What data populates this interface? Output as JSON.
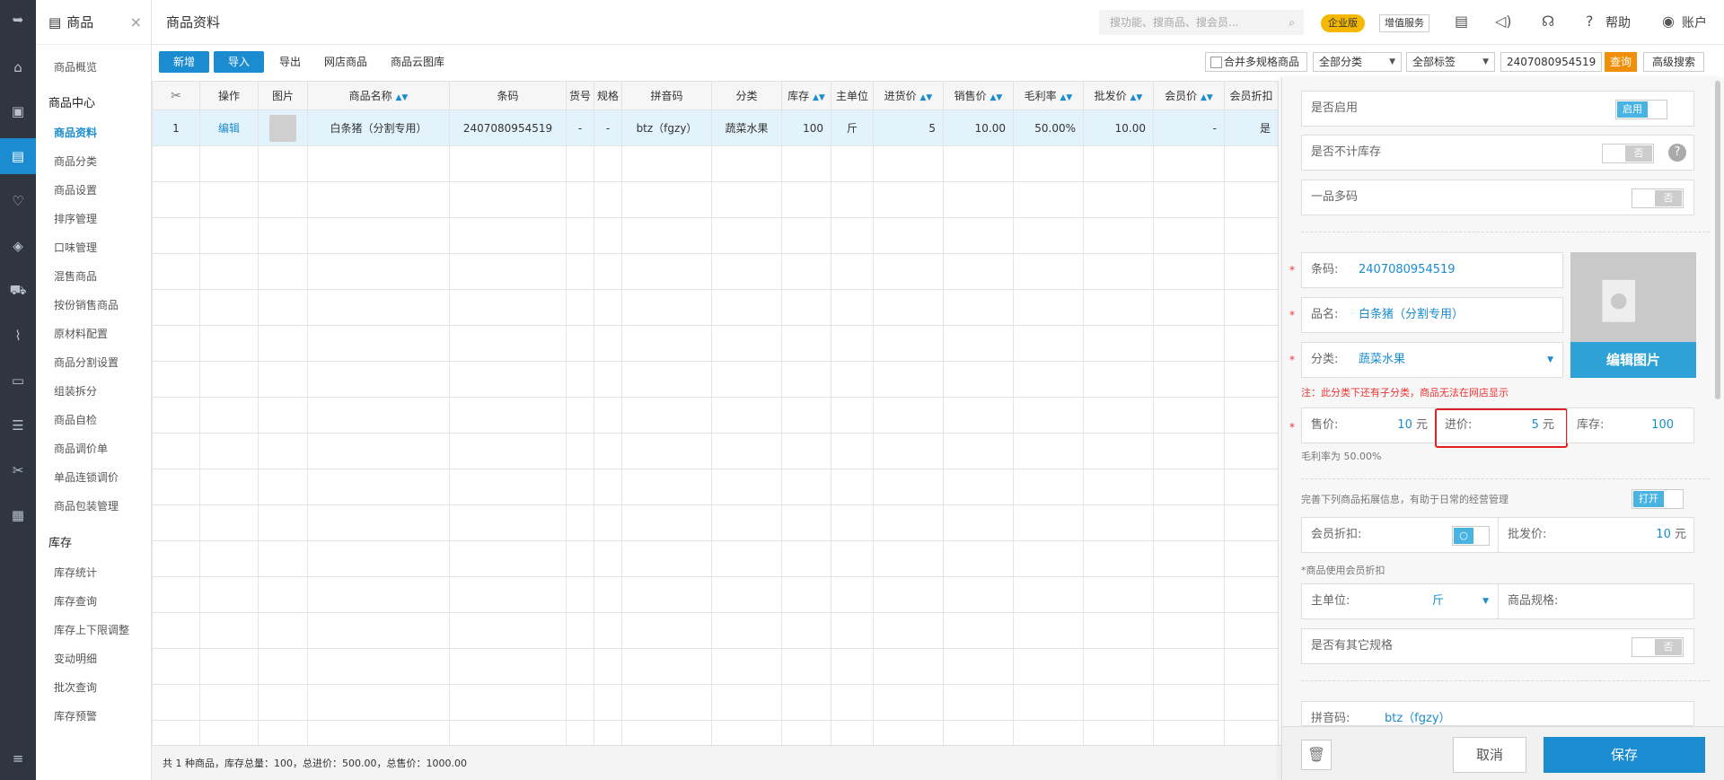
{
  "nav": {
    "title": "商品",
    "close": "×",
    "items": [
      "商品概览"
    ],
    "group1": "商品中心",
    "group1_items": [
      "商品资料",
      "商品分类",
      "商品设置",
      "排序管理",
      "口味管理",
      "混售商品",
      "按份销售商品",
      "原材料配置",
      "商品分割设置",
      "组装拆分",
      "商品自检",
      "商品调价单",
      "单品连锁调价",
      "商品包装管理"
    ],
    "group2": "库存",
    "group2_items": [
      "库存统计",
      "库存查询",
      "库存上下限调整",
      "变动明细",
      "批次查询",
      "库存预警"
    ]
  },
  "topbar": {
    "title": "商品资料",
    "search_placeholder": "搜功能、搜商品、搜会员...",
    "badge_enterprise": "企业版",
    "badge_vas": "增值服务",
    "help": "帮助",
    "account": "账户"
  },
  "toolbar": {
    "new": "新增",
    "import": "导入",
    "export": "导出",
    "online": "网店商品",
    "cloud": "商品云图库",
    "merge_spec": "合并多规格商品",
    "category": "全部分类",
    "tag": "全部标签",
    "query_value": "2407080954519",
    "query": "查询",
    "advanced": "高级搜索"
  },
  "table": {
    "headers": [
      "",
      "操作",
      "图片",
      "商品名称",
      "条码",
      "货号",
      "规格",
      "拼音码",
      "分类",
      "库存",
      "主单位",
      "进货价",
      "销售价",
      "毛利率",
      "批发价",
      "会员价",
      "会员折扣"
    ],
    "row": {
      "index": "1",
      "action": "编辑",
      "name": "白条猪（分割专用）",
      "barcode": "2407080954519",
      "sku": "-",
      "spec": "-",
      "pinyin": "btz（fgzy）",
      "category": "蔬菜水果",
      "stock": "100",
      "unit": "斤",
      "cost": "5",
      "price": "10.00",
      "margin": "50.00%",
      "wholesale": "10.00",
      "member_price": "-",
      "member_discount": "是"
    },
    "footer": "共 1 种商品，库存总量：100，总进价：500.00，总售价：1000.00"
  },
  "panel": {
    "enabled_label": "是否启用",
    "enabled_value": "启用",
    "no_stock_label": "是否不计库存",
    "no_stock_value": "否",
    "multi_code_label": "一品多码",
    "multi_code_value": "否",
    "barcode_label": "条码:",
    "barcode_value": "2407080954519",
    "name_label": "品名:",
    "name_value": "白条猪（分割专用）",
    "category_label": "分类:",
    "category_value": "蔬菜水果",
    "edit_image": "编辑图片",
    "warn": "注：此分类下还有子分类，商品无法在网店显示",
    "price_label": "售价:",
    "price_value": "10",
    "cost_label": "进价:",
    "cost_value": "5",
    "unit_yuan": "元",
    "stock_label": "库存:",
    "stock_value": "100",
    "margin_hint": "毛利率为 50.00%",
    "ext_hint": "完善下列商品拓展信息，有助于日常的经营管理",
    "ext_toggle": "打开",
    "member_discount_label": "会员折扣:",
    "member_discount_toggle": "○",
    "wholesale_label": "批发价:",
    "wholesale_value": "10",
    "member_hint": "*商品使用会员折扣",
    "main_unit_label": "主单位:",
    "main_unit_value": "斤",
    "spec_label": "商品规格:",
    "other_spec_label": "是否有其它规格",
    "other_spec_value": "否",
    "pinyin_label": "拼音码:",
    "pinyin_value": "btz（fgzy）",
    "cancel": "取消",
    "save": "保存"
  },
  "colors": {
    "accent": "#1a8ccf",
    "warn": "#e02020",
    "enterprise": "#f5b800"
  }
}
